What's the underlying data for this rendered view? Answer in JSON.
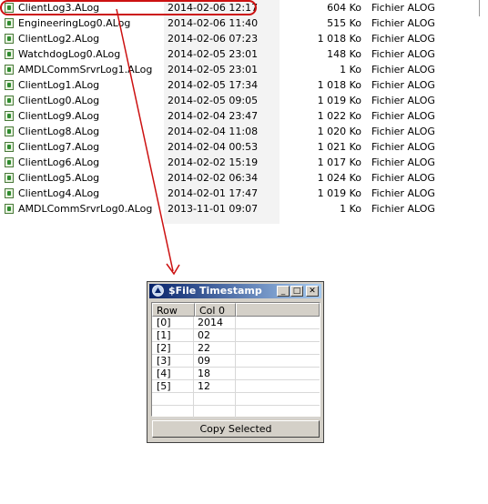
{
  "files": [
    {
      "name": "ClientLog3.ALog",
      "date": "2014-02-06 12:17",
      "size": "604 Ko",
      "type": "Fichier ALOG"
    },
    {
      "name": "EngineeringLog0.ALog",
      "date": "2014-02-06 11:40",
      "size": "515 Ko",
      "type": "Fichier ALOG"
    },
    {
      "name": "ClientLog2.ALog",
      "date": "2014-02-06 07:23",
      "size": "1 018 Ko",
      "type": "Fichier ALOG"
    },
    {
      "name": "WatchdogLog0.ALog",
      "date": "2014-02-05 23:01",
      "size": "148 Ko",
      "type": "Fichier ALOG"
    },
    {
      "name": "AMDLCommSrvrLog1.ALog",
      "date": "2014-02-05 23:01",
      "size": "1 Ko",
      "type": "Fichier ALOG"
    },
    {
      "name": "ClientLog1.ALog",
      "date": "2014-02-05 17:34",
      "size": "1 018 Ko",
      "type": "Fichier ALOG"
    },
    {
      "name": "ClientLog0.ALog",
      "date": "2014-02-05 09:05",
      "size": "1 019 Ko",
      "type": "Fichier ALOG"
    },
    {
      "name": "ClientLog9.ALog",
      "date": "2014-02-04 23:47",
      "size": "1 022 Ko",
      "type": "Fichier ALOG"
    },
    {
      "name": "ClientLog8.ALog",
      "date": "2014-02-04 11:08",
      "size": "1 020 Ko",
      "type": "Fichier ALOG"
    },
    {
      "name": "ClientLog7.ALog",
      "date": "2014-02-04 00:53",
      "size": "1 021 Ko",
      "type": "Fichier ALOG"
    },
    {
      "name": "ClientLog6.ALog",
      "date": "2014-02-02 15:19",
      "size": "1 017 Ko",
      "type": "Fichier ALOG"
    },
    {
      "name": "ClientLog5.ALog",
      "date": "2014-02-02 06:34",
      "size": "1 024 Ko",
      "type": "Fichier ALOG"
    },
    {
      "name": "ClientLog4.ALog",
      "date": "2014-02-01 17:47",
      "size": "1 019 Ko",
      "type": "Fichier ALOG"
    },
    {
      "name": "AMDLCommSrvrLog0.ALog",
      "date": "2013-11-01 09:07",
      "size": "1 Ko",
      "type": "Fichier ALOG"
    }
  ],
  "file_icon": "alog-file-icon",
  "annotation_color": "#cc1111",
  "dialog": {
    "title": "$File Timestamp",
    "icon": "labview-app-icon",
    "minimize_label": "_",
    "maximize_label": "□",
    "close_label": "✕",
    "columns": [
      "Row",
      "Col 0"
    ],
    "rows": [
      {
        "index": "[0]",
        "value": "2014"
      },
      {
        "index": "[1]",
        "value": "02"
      },
      {
        "index": "[2]",
        "value": "22"
      },
      {
        "index": "[3]",
        "value": "09"
      },
      {
        "index": "[4]",
        "value": "18"
      },
      {
        "index": "[5]",
        "value": "12"
      }
    ],
    "copy_button": "Copy Selected",
    "title_gradient": [
      "#08246b",
      "#a6caf0"
    ]
  }
}
